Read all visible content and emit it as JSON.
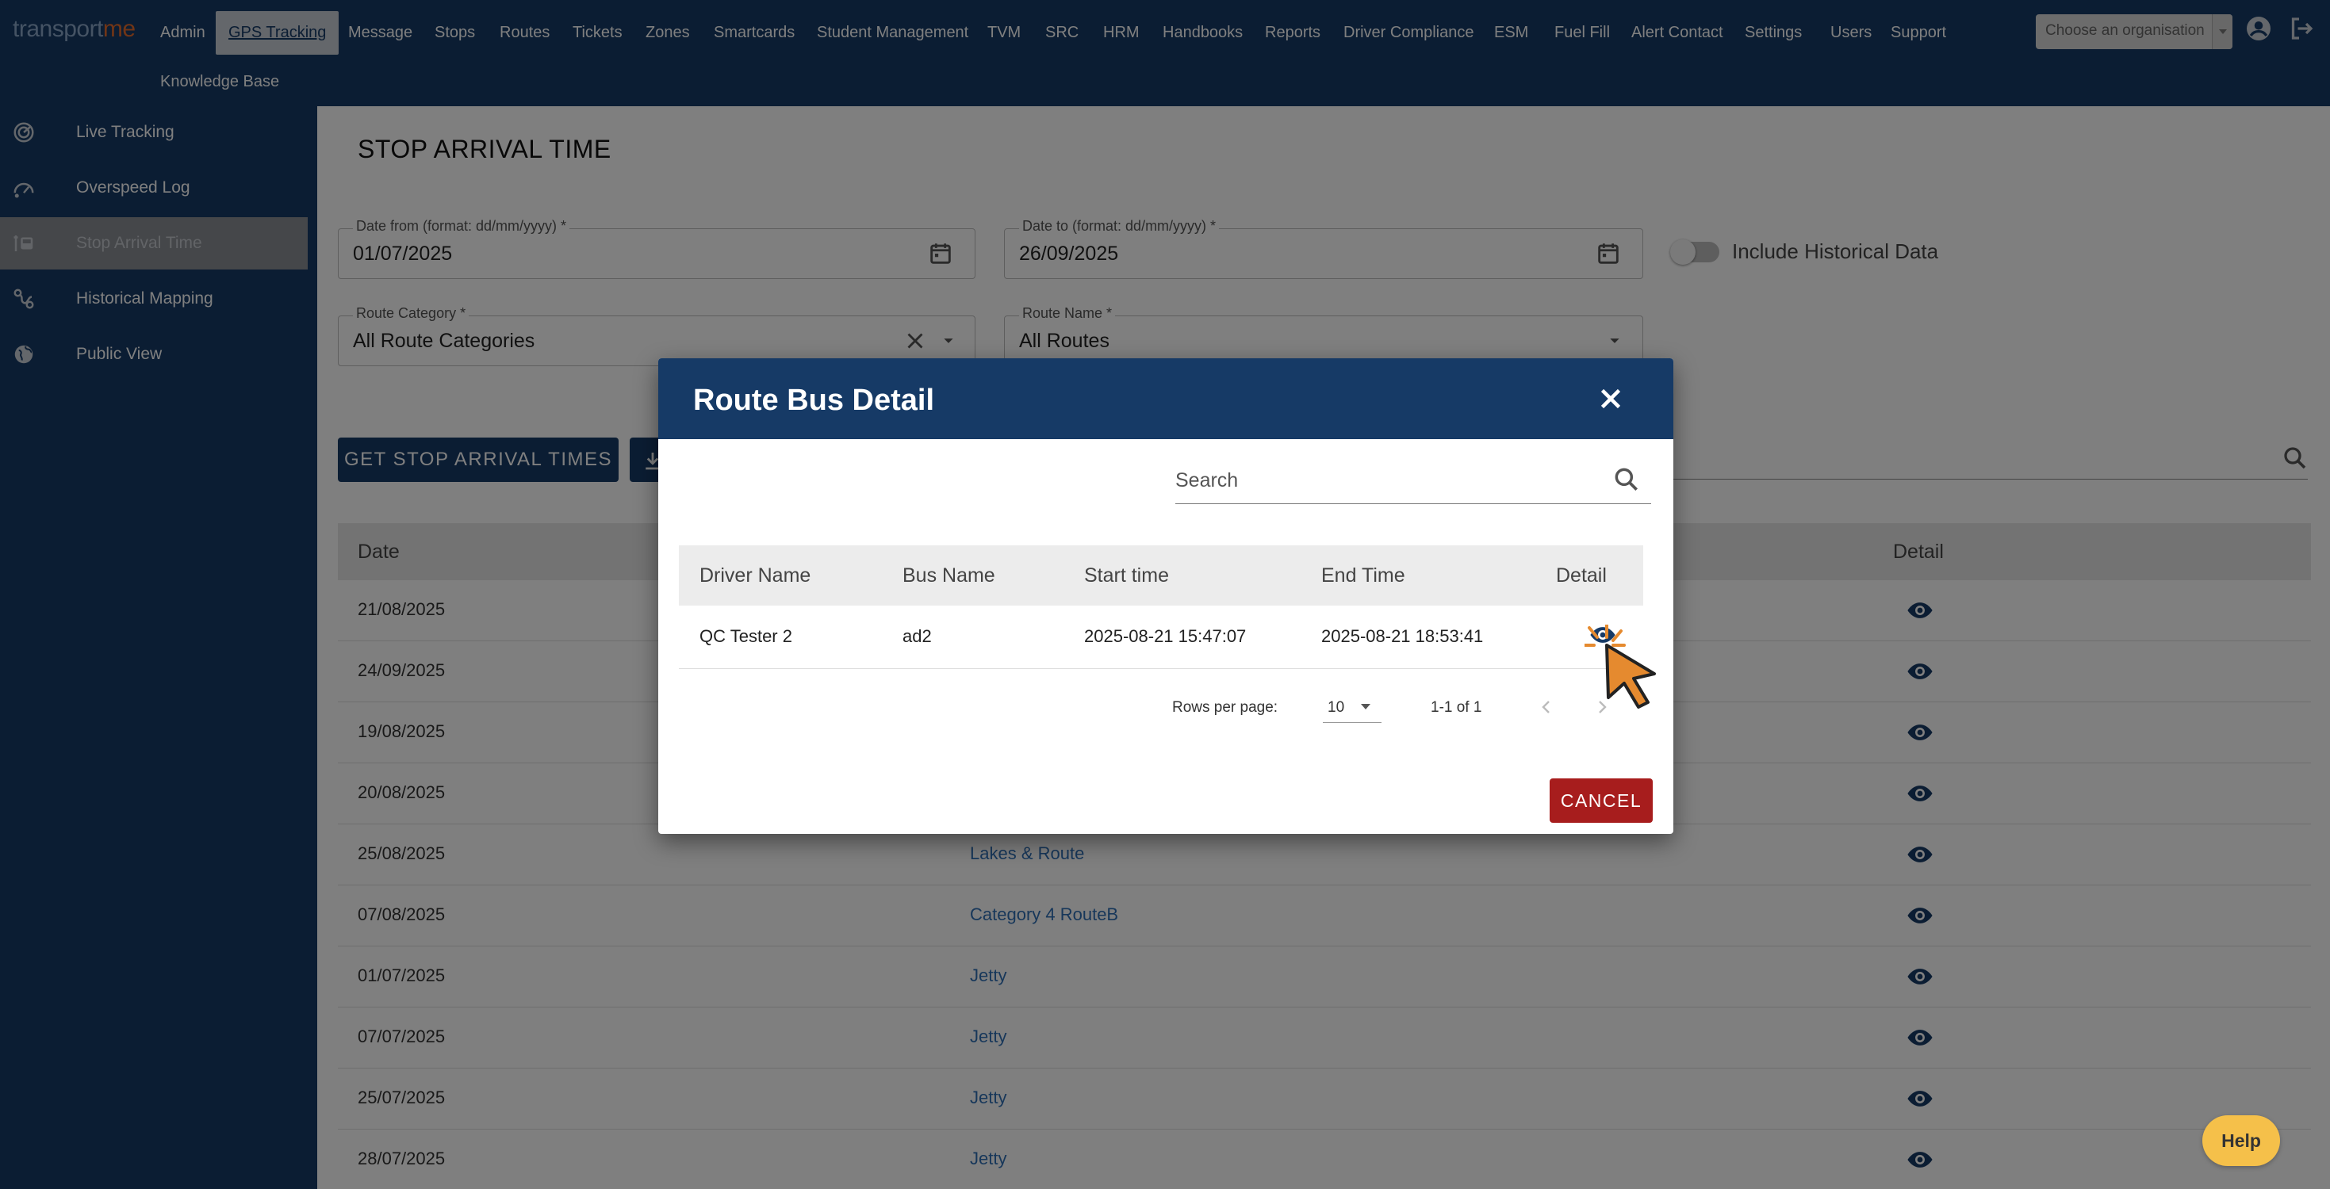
{
  "brand": {
    "part1": "transport",
    "part2": "me"
  },
  "nav": {
    "items": [
      "Admin",
      "GPS Tracking",
      "Message",
      "Stops",
      "Routes",
      "Tickets",
      "Zones",
      "Smartcards",
      "Student Management",
      "TVM",
      "SRC",
      "HRM",
      "Handbooks",
      "Reports",
      "Driver Compliance",
      "ESM",
      "Fuel Fill",
      "Alert Contact",
      "Settings",
      "Users",
      "Support"
    ],
    "second_row": "Knowledge Base",
    "active": "GPS Tracking",
    "org_placeholder": "Choose an organisation"
  },
  "sidebar": {
    "items": [
      {
        "label": "Live Tracking",
        "icon": "radar-icon"
      },
      {
        "label": "Overspeed Log",
        "icon": "speedometer-icon"
      },
      {
        "label": "Stop Arrival Time",
        "icon": "bus-stop-icon"
      },
      {
        "label": "Historical Mapping",
        "icon": "route-map-icon"
      },
      {
        "label": "Public View",
        "icon": "globe-icon"
      }
    ],
    "active": "Stop Arrival Time"
  },
  "page": {
    "title": "STOP ARRIVAL TIME",
    "date_from": {
      "label": "Date from (format: dd/mm/yyyy) *",
      "value": "01/07/2025"
    },
    "date_to": {
      "label": "Date to (format: dd/mm/yyyy) *",
      "value": "26/09/2025"
    },
    "include_historical": {
      "label": "Include Historical Data",
      "checked": false
    },
    "route_category": {
      "label": "Route Category *",
      "value": "All Route Categories"
    },
    "route_name": {
      "label": "Route Name *",
      "value": "All Routes"
    },
    "get_button": "GET STOP ARRIVAL TIMES",
    "table": {
      "headers": {
        "date": "Date",
        "detail": "Detail"
      },
      "rows": [
        {
          "date": "21/08/2025",
          "route": ""
        },
        {
          "date": "24/09/2025",
          "route": ""
        },
        {
          "date": "19/08/2025",
          "route": ""
        },
        {
          "date": "20/08/2025",
          "route": ""
        },
        {
          "date": "25/08/2025",
          "route": "Lakes & Route"
        },
        {
          "date": "07/08/2025",
          "route": "Category 4 RouteB"
        },
        {
          "date": "01/07/2025",
          "route": "Jetty"
        },
        {
          "date": "07/07/2025",
          "route": "Jetty"
        },
        {
          "date": "25/07/2025",
          "route": "Jetty"
        },
        {
          "date": "28/07/2025",
          "route": "Jetty"
        }
      ]
    },
    "help": "Help"
  },
  "dialog": {
    "title": "Route Bus Detail",
    "search_placeholder": "Search",
    "headers": {
      "driver": "Driver Name",
      "bus": "Bus Name",
      "start": "Start time",
      "end": "End Time",
      "detail": "Detail"
    },
    "rows": [
      {
        "driver": "QC Tester 2",
        "bus": "ad2",
        "start": "2025-08-21 15:47:07",
        "end": "2025-08-21 18:53:41"
      }
    ],
    "pagination": {
      "rows_per_page_label": "Rows per page:",
      "rows_per_page": "10",
      "range": "1-1 of 1"
    },
    "cancel": "CANCEL"
  },
  "colors": {
    "navy": "#163a66",
    "accent_orange": "#e26b2d",
    "link_blue": "#2f6fb5",
    "cancel_red": "#a71d1d",
    "help_yellow": "#f5c04a"
  }
}
